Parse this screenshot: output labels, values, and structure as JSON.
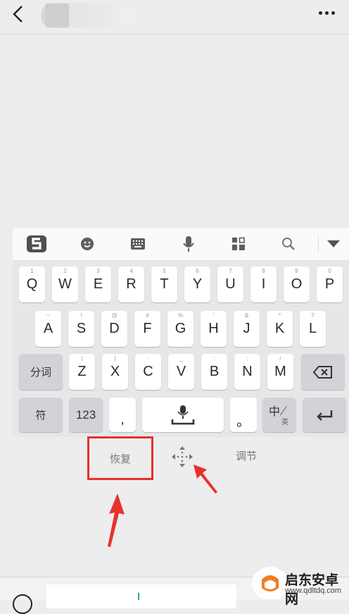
{
  "keyboard": {
    "rows": [
      [
        {
          "main": "Q",
          "sub": "1"
        },
        {
          "main": "W",
          "sub": "2"
        },
        {
          "main": "E",
          "sub": "3"
        },
        {
          "main": "R",
          "sub": "4"
        },
        {
          "main": "T",
          "sub": "5"
        },
        {
          "main": "Y",
          "sub": "6"
        },
        {
          "main": "U",
          "sub": "7"
        },
        {
          "main": "I",
          "sub": "8"
        },
        {
          "main": "O",
          "sub": "9"
        },
        {
          "main": "P",
          "sub": "0"
        }
      ],
      [
        {
          "main": "A",
          "sub": "~"
        },
        {
          "main": "S",
          "sub": "!"
        },
        {
          "main": "D",
          "sub": "@"
        },
        {
          "main": "F",
          "sub": "#"
        },
        {
          "main": "G",
          "sub": "%"
        },
        {
          "main": "H",
          "sub": "'"
        },
        {
          "main": "J",
          "sub": "&"
        },
        {
          "main": "K",
          "sub": "*"
        },
        {
          "main": "L",
          "sub": "?"
        }
      ],
      [
        {
          "main": "Z",
          "sub": "("
        },
        {
          "main": "X",
          "sub": ")"
        },
        {
          "main": "C",
          "sub": "-"
        },
        {
          "main": "V",
          "sub": "_"
        },
        {
          "main": "B",
          "sub": ":"
        },
        {
          "main": "N",
          "sub": ";"
        },
        {
          "main": "M",
          "sub": "/"
        }
      ]
    ],
    "split_word_label": "分词",
    "symbol_label": "符",
    "num_label": "123",
    "comma_label": ",",
    "period_label": "。",
    "lang_main": "中",
    "lang_sub": "英"
  },
  "below_keyboard": {
    "restore_label": "恢复",
    "adjust_label": "调节"
  },
  "watermark": {
    "name": "启东安卓网",
    "url": "www.qdltdq.com"
  },
  "colors": {
    "highlight_red": "#e8312c",
    "caret_green": "#21b05a"
  }
}
